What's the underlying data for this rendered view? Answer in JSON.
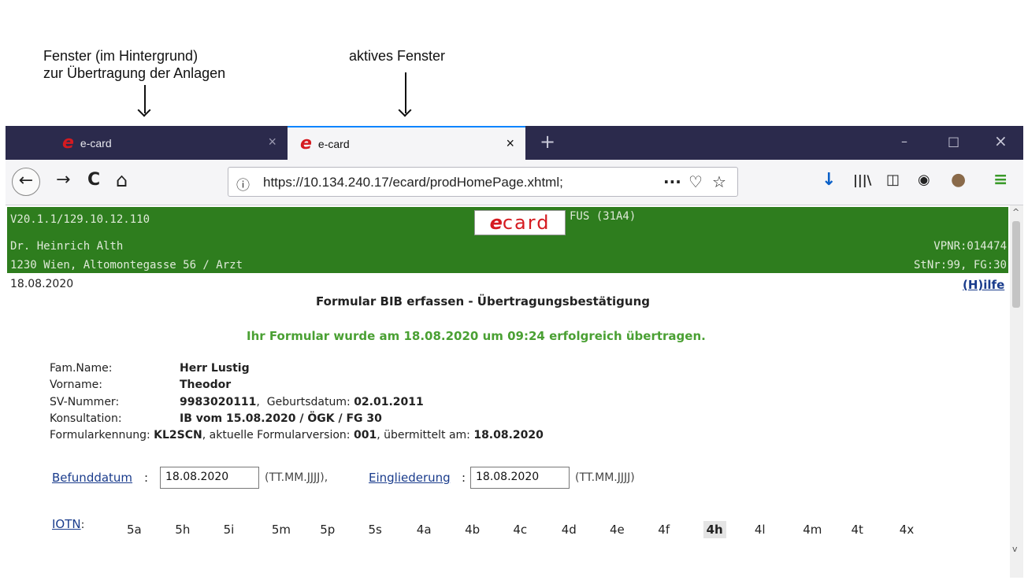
{
  "annotations": {
    "left_line1": "Fenster (im Hintergrund)",
    "left_line2": "zur Übertragung der Anlagen",
    "right": "aktives Fenster"
  },
  "browser": {
    "tabs": [
      {
        "title": "e-card",
        "logo": "e",
        "close": "×"
      },
      {
        "title": "e-card",
        "logo": "e",
        "close": "×"
      }
    ],
    "new_tab": "+",
    "url": "https://10.134.240.17/ecard/prodHomePage.xhtml;",
    "icons": {
      "back": "←",
      "forward": "→",
      "reload": "C",
      "home": "⌂",
      "info": "ⓘ",
      "more": "···",
      "pocket": "♡",
      "bookmark": "☆",
      "download": "↓",
      "library": "|||\\",
      "reader": "◫",
      "account": "◉",
      "extension": "●",
      "menu": "≡",
      "minimize": "–",
      "maximize": "□",
      "close": "×"
    }
  },
  "header": {
    "version": "V20.1.1/129.10.12.110",
    "logo_e": "e",
    "logo_card": "card",
    "fus": "FUS (31A4)",
    "doctor": "Dr. Heinrich Alth",
    "address": "1230 Wien, Altomontegasse 56 / Arzt",
    "vpnr": "VPNR:014474",
    "stnr": "StNr:99, FG:30"
  },
  "page": {
    "date": "18.08.2020",
    "help": "(H)ilfe",
    "title": "Formular BIB erfassen - Übertragungsbestätigung",
    "success": "Ihr Formular wurde am 18.08.2020 um 09:24 erfolgreich übertragen.",
    "fields": {
      "famname_label": "Fam.Name:",
      "famname_value": "Herr Lustig",
      "vorname_label": "Vorname:",
      "vorname_value": "Theodor",
      "sv_label": "SV-Nummer:",
      "sv_value": "9983020111",
      "geb_label": "Geburtsdatum:",
      "geb_value": "02.01.2011",
      "kons_label": "Konsultation:",
      "kons_value": "IB vom 15.08.2020 / ÖGK / FG 30",
      "fk_label": "Formularkennung:",
      "fk_value": "KL2SCN",
      "fv_label": "aktuelle Formularversion:",
      "fv_value": "001",
      "ue_label": "übermittelt am:",
      "ue_value": "18.08.2020"
    },
    "befund_label": "Befunddatum",
    "befund_value": "18.08.2020",
    "format_hint": "(TT.MM.JJJJ),",
    "eingl_label": "Eingliederung",
    "eingl_value": "18.08.2020",
    "format_hint2": "(TT.MM.JJJJ)",
    "iotn_label": "IOTN",
    "iotn_options": [
      "5a",
      "5h",
      "5i",
      "5m",
      "5p",
      "5s",
      "4a",
      "4b",
      "4c",
      "4d",
      "4e",
      "4f",
      "4h",
      "4l",
      "4m",
      "4t",
      "4x"
    ],
    "iotn_selected": "4h"
  }
}
